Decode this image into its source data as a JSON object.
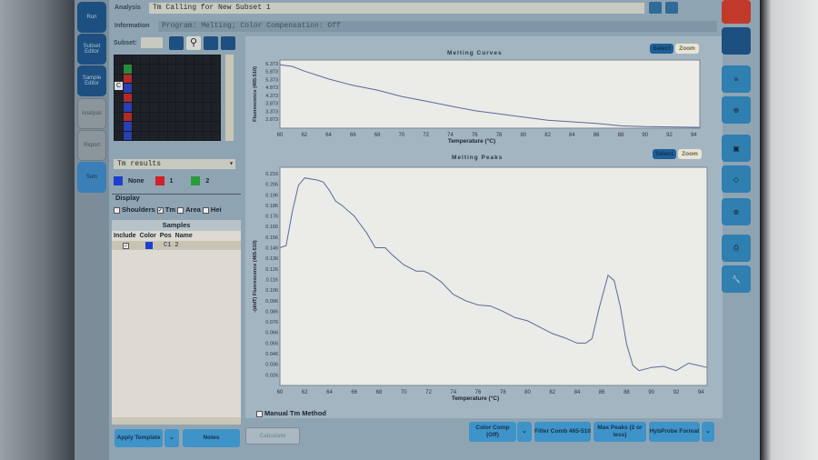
{
  "nav": {
    "items": [
      {
        "label": "Run"
      },
      {
        "label": "Subset Editor"
      },
      {
        "label": "Sample Editor"
      },
      {
        "label": "Analysis"
      },
      {
        "label": "Report"
      },
      {
        "label": "Sum"
      }
    ]
  },
  "header": {
    "analysis_label": "Analysis",
    "analysis_value": "Tm Calling for New Subset 1",
    "information_label": "Information",
    "information_value": "Program: Melting; Color Compensation: Off"
  },
  "subset": {
    "label": "Subset:",
    "row_label": "C"
  },
  "results_select": "Tm results",
  "legend": [
    {
      "label": "None",
      "color": "#1d3fd0"
    },
    {
      "label": "1",
      "color": "#d0202a"
    },
    {
      "label": "2",
      "color": "#2a9a3a"
    }
  ],
  "display": {
    "title": "Display",
    "options": [
      {
        "label": "Shoulders",
        "checked": false
      },
      {
        "label": "Tm",
        "checked": true
      },
      {
        "label": "Area",
        "checked": false
      },
      {
        "label": "Hei",
        "checked": false
      }
    ]
  },
  "samples": {
    "title": "Samples",
    "columns": [
      "Include",
      "Color",
      "Pos",
      "Name"
    ],
    "rows": [
      {
        "include": true,
        "color": "#1d3fd0",
        "pos": "C1",
        "name": "2"
      }
    ]
  },
  "buttons": {
    "apply_template": "Apply Template",
    "notes": "Notes",
    "calculate": "Calculate",
    "color_comp": "Color Comp (Off)",
    "filter_comb": "Filter Comb 465-510",
    "max_peaks": "Max Peaks (2 or less)",
    "hybprobe": "HybProbe Format",
    "select": "Select",
    "zoom": "Zoom"
  },
  "manual_tm": {
    "label": "Manual Tm Method",
    "checked": false
  },
  "chart_data": [
    {
      "type": "line",
      "title": "Melting Curves",
      "xlabel": "Temperature (°C)",
      "ylabel": "Fluorescence (465-510)",
      "xlim": [
        60,
        94.5
      ],
      "ylim": [
        2.3,
        6.6
      ],
      "xticks": [
        60,
        62,
        64,
        66,
        68,
        70,
        72,
        74,
        76,
        78,
        80,
        82,
        84,
        86,
        88,
        90,
        92,
        94
      ],
      "yticks": [
        "6.373",
        "5.873",
        "5.373",
        "4.873",
        "4.373",
        "3.873",
        "3.373",
        "2.873"
      ],
      "x": [
        60,
        61,
        62,
        64,
        66,
        68,
        70,
        72,
        74,
        76,
        78,
        80,
        82,
        84,
        86,
        88,
        90,
        92,
        94.5
      ],
      "y": [
        6.3,
        6.2,
        5.9,
        5.4,
        5.0,
        4.7,
        4.3,
        4.0,
        3.7,
        3.4,
        3.2,
        3.0,
        2.8,
        2.7,
        2.6,
        2.45,
        2.4,
        2.38,
        2.35
      ]
    },
    {
      "type": "line",
      "title": "Melting Peaks",
      "xlabel": "Temperature (°C)",
      "ylabel": "-(d/dT) Fluorescence (465-510)",
      "xlim": [
        60,
        94.5
      ],
      "ylim": [
        0.016,
        0.222
      ],
      "xticks": [
        60,
        62,
        64,
        66,
        68,
        70,
        72,
        74,
        76,
        78,
        80,
        82,
        84,
        86,
        88,
        90,
        92,
        94
      ],
      "yticks": [
        "0.216",
        "0.206",
        "0.196",
        "0.186",
        "0.176",
        "0.166",
        "0.156",
        "0.146",
        "0.136",
        "0.126",
        "0.116",
        "0.106",
        "0.096",
        "0.086",
        "0.076",
        "0.066",
        "0.056",
        "0.046",
        "0.036",
        "0.026"
      ],
      "x": [
        60,
        60.5,
        61,
        61.5,
        62,
        63,
        63.5,
        64,
        64.5,
        65,
        66,
        67,
        67.7,
        68.5,
        69,
        70,
        71,
        71.6,
        72,
        73,
        74,
        75,
        76,
        77,
        78,
        79,
        80,
        81,
        82,
        83,
        84,
        84.7,
        85.2,
        85.8,
        86.5,
        87,
        87.5,
        88,
        88.5,
        89,
        90,
        91,
        92,
        93,
        94.5
      ],
      "y": [
        0.146,
        0.148,
        0.18,
        0.205,
        0.212,
        0.21,
        0.208,
        0.2,
        0.19,
        0.186,
        0.176,
        0.16,
        0.146,
        0.146,
        0.14,
        0.13,
        0.124,
        0.124,
        0.122,
        0.114,
        0.102,
        0.096,
        0.092,
        0.091,
        0.086,
        0.08,
        0.077,
        0.071,
        0.065,
        0.061,
        0.056,
        0.056,
        0.06,
        0.09,
        0.12,
        0.115,
        0.09,
        0.055,
        0.035,
        0.03,
        0.033,
        0.034,
        0.03,
        0.037,
        0.033
      ]
    }
  ]
}
